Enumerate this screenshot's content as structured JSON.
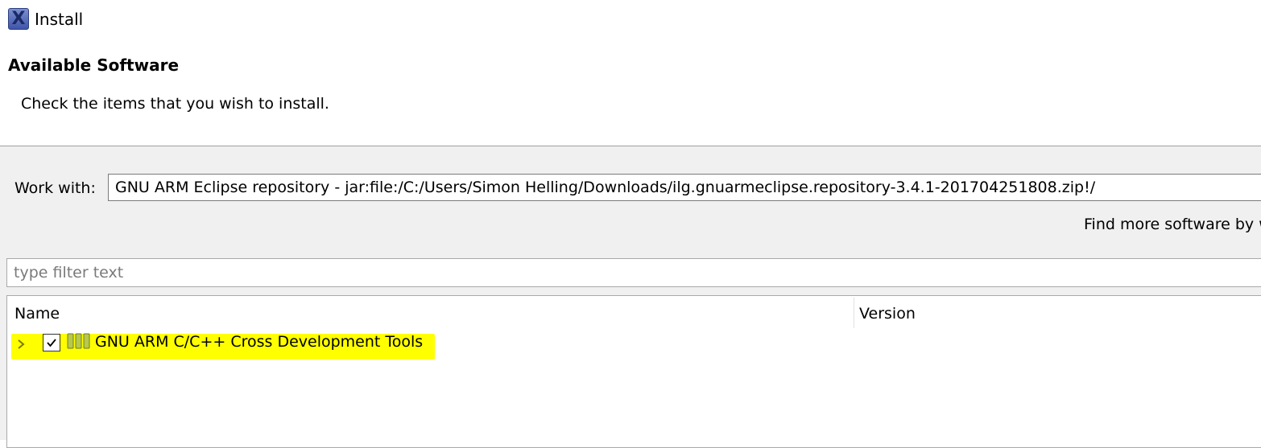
{
  "window": {
    "title": "Install",
    "icon": "eclipse-install-icon"
  },
  "header": {
    "title": "Available Software",
    "description": "Check the items that you wish to install."
  },
  "work_with": {
    "label": "Work with:",
    "value": "GNU ARM Eclipse repository - jar:file:/C:/Users/Simon Helling/Downloads/ilg.gnuarmeclipse.repository-3.4.1-201704251808.zip!/"
  },
  "find_more": {
    "text": "Find more software by w"
  },
  "filter": {
    "placeholder": "type filter text",
    "value": ""
  },
  "tree": {
    "columns": [
      "Name",
      "Version"
    ],
    "rows": [
      {
        "label": "GNU ARM C/C++ Cross Development Tools",
        "version": "",
        "checked": true,
        "expanded": false,
        "highlight_color": "#ffff00"
      }
    ]
  }
}
